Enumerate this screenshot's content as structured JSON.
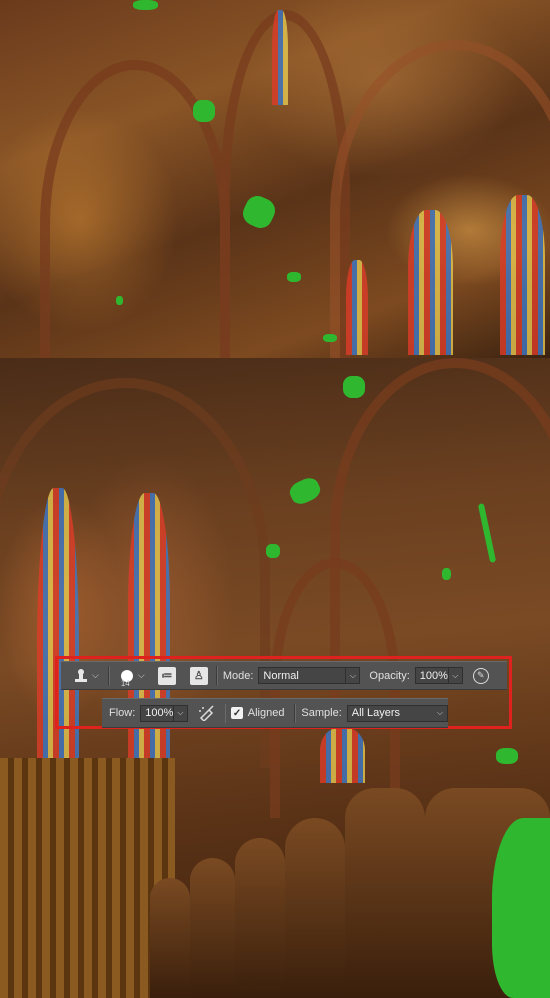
{
  "options_bar": {
    "tool_preset_icon": "clone-stamp-icon",
    "brush_size": "14",
    "clone_source_panel_icon": "clone-source-icon",
    "toggle_clone_panel_icon": "stamp-panel-icon",
    "mode_label": "Mode:",
    "mode_value": "Normal",
    "opacity_label": "Opacity:",
    "opacity_value": "100%",
    "pressure_opacity_icon": "pen-pressure-icon",
    "flow_label": "Flow:",
    "flow_value": "100%",
    "airbrush_icon": "airbrush-icon",
    "aligned_label": "Aligned",
    "aligned_checked": true,
    "sample_label": "Sample:",
    "sample_value": "All Layers"
  },
  "colors": {
    "highlight_frame": "#e0221e",
    "bar_background": "#535353",
    "paint_marks": "#2fb82f"
  }
}
